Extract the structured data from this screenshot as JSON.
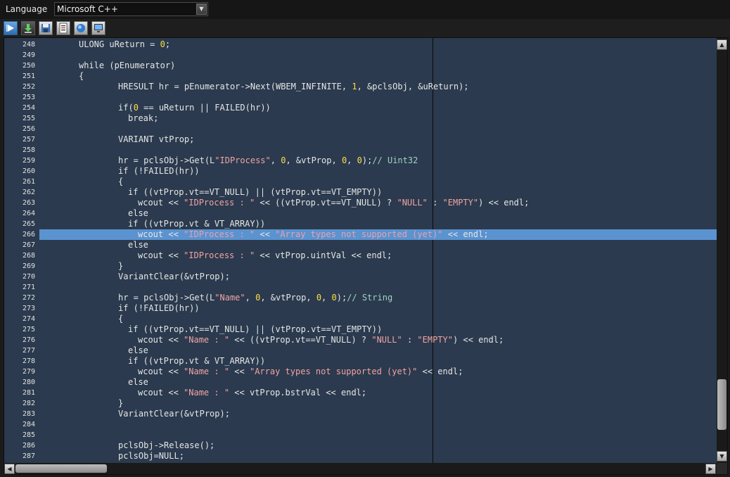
{
  "language": {
    "label": "Language",
    "selected": "Microsoft C++"
  },
  "toolbar": {
    "buttons": [
      {
        "name": "run-icon",
        "active": true
      },
      {
        "name": "download-icon"
      },
      {
        "name": "save-icon"
      },
      {
        "name": "properties-icon"
      },
      {
        "name": "globe-icon"
      },
      {
        "name": "monitor-icon"
      }
    ]
  },
  "editor": {
    "highlighted_line": 266,
    "lines": [
      {
        "n": "248",
        "indent": 1,
        "tokens": [
          [
            "t",
            "ULONG uReturn = "
          ],
          [
            "n",
            "0"
          ],
          [
            "t",
            ";"
          ]
        ]
      },
      {
        "n": "249",
        "indent": 0,
        "tokens": []
      },
      {
        "n": "250",
        "indent": 1,
        "tokens": [
          [
            "t",
            "while (pEnumerator)"
          ]
        ]
      },
      {
        "n": "251",
        "indent": 1,
        "tokens": [
          [
            "t",
            "{"
          ]
        ]
      },
      {
        "n": "252",
        "indent": 2,
        "tokens": [
          [
            "t",
            "HRESULT hr = pEnumerator->Next(WBEM_INFINITE, "
          ],
          [
            "n",
            "1"
          ],
          [
            "t",
            ", &pclsObj, &uReturn);"
          ]
        ]
      },
      {
        "n": "253",
        "indent": 0,
        "tokens": []
      },
      {
        "n": "254",
        "indent": 2,
        "tokens": [
          [
            "t",
            "if("
          ],
          [
            "n",
            "0"
          ],
          [
            "t",
            " == uReturn || FAILED(hr))"
          ]
        ]
      },
      {
        "n": "255",
        "indent": 3,
        "tokens": [
          [
            "t",
            "break;"
          ]
        ]
      },
      {
        "n": "256",
        "indent": 0,
        "tokens": []
      },
      {
        "n": "257",
        "indent": 2,
        "tokens": [
          [
            "t",
            "VARIANT vtProp;"
          ]
        ]
      },
      {
        "n": "258",
        "indent": 0,
        "tokens": []
      },
      {
        "n": "259",
        "indent": 2,
        "tokens": [
          [
            "t",
            "hr = pclsObj->Get(L"
          ],
          [
            "s",
            "\"IDProcess\""
          ],
          [
            "t",
            ", "
          ],
          [
            "n",
            "0"
          ],
          [
            "t",
            ", &vtProp, "
          ],
          [
            "n",
            "0"
          ],
          [
            "t",
            ", "
          ],
          [
            "n",
            "0"
          ],
          [
            "t",
            ");"
          ],
          [
            "c",
            "// Uint32"
          ]
        ]
      },
      {
        "n": "260",
        "indent": 2,
        "tokens": [
          [
            "t",
            "if (!FAILED(hr))"
          ]
        ]
      },
      {
        "n": "261",
        "indent": 2,
        "tokens": [
          [
            "t",
            "{"
          ]
        ]
      },
      {
        "n": "262",
        "indent": 3,
        "tokens": [
          [
            "t",
            "if ((vtProp.vt==VT_NULL) || (vtProp.vt==VT_EMPTY))"
          ]
        ]
      },
      {
        "n": "263",
        "indent": 4,
        "tokens": [
          [
            "t",
            "wcout << "
          ],
          [
            "s",
            "\"IDProcess : \""
          ],
          [
            "t",
            " << ((vtProp.vt==VT_NULL) ? "
          ],
          [
            "s",
            "\"NULL\""
          ],
          [
            "t",
            " : "
          ],
          [
            "s",
            "\"EMPTY\""
          ],
          [
            "t",
            ") << endl;"
          ]
        ]
      },
      {
        "n": "264",
        "indent": 3,
        "tokens": [
          [
            "t",
            "else"
          ]
        ]
      },
      {
        "n": "265",
        "indent": 3,
        "tokens": [
          [
            "t",
            "if ((vtProp.vt & VT_ARRAY))"
          ]
        ]
      },
      {
        "n": "266",
        "indent": 4,
        "tokens": [
          [
            "t",
            "wcout << "
          ],
          [
            "s",
            "\"IDProcess : \""
          ],
          [
            "t",
            " << "
          ],
          [
            "s",
            "\"Array types not supported (yet)\""
          ],
          [
            "t",
            " << endl;"
          ]
        ]
      },
      {
        "n": "267",
        "indent": 3,
        "tokens": [
          [
            "t",
            "else"
          ]
        ]
      },
      {
        "n": "268",
        "indent": 4,
        "tokens": [
          [
            "t",
            "wcout << "
          ],
          [
            "s",
            "\"IDProcess : \""
          ],
          [
            "t",
            " << vtProp.uintVal << endl;"
          ]
        ]
      },
      {
        "n": "269",
        "indent": 2,
        "tokens": [
          [
            "t",
            "}"
          ]
        ]
      },
      {
        "n": "270",
        "indent": 2,
        "tokens": [
          [
            "t",
            "VariantClear(&vtProp);"
          ]
        ]
      },
      {
        "n": "271",
        "indent": 0,
        "tokens": []
      },
      {
        "n": "272",
        "indent": 2,
        "tokens": [
          [
            "t",
            "hr = pclsObj->Get(L"
          ],
          [
            "s",
            "\"Name\""
          ],
          [
            "t",
            ", "
          ],
          [
            "n",
            "0"
          ],
          [
            "t",
            ", &vtProp, "
          ],
          [
            "n",
            "0"
          ],
          [
            "t",
            ", "
          ],
          [
            "n",
            "0"
          ],
          [
            "t",
            ");"
          ],
          [
            "c",
            "// String"
          ]
        ]
      },
      {
        "n": "273",
        "indent": 2,
        "tokens": [
          [
            "t",
            "if (!FAILED(hr))"
          ]
        ]
      },
      {
        "n": "274",
        "indent": 2,
        "tokens": [
          [
            "t",
            "{"
          ]
        ]
      },
      {
        "n": "275",
        "indent": 3,
        "tokens": [
          [
            "t",
            "if ((vtProp.vt==VT_NULL) || (vtProp.vt==VT_EMPTY))"
          ]
        ]
      },
      {
        "n": "276",
        "indent": 4,
        "tokens": [
          [
            "t",
            "wcout << "
          ],
          [
            "s",
            "\"Name : \""
          ],
          [
            "t",
            " << ((vtProp.vt==VT_NULL) ? "
          ],
          [
            "s",
            "\"NULL\""
          ],
          [
            "t",
            " : "
          ],
          [
            "s",
            "\"EMPTY\""
          ],
          [
            "t",
            ") << endl;"
          ]
        ]
      },
      {
        "n": "277",
        "indent": 3,
        "tokens": [
          [
            "t",
            "else"
          ]
        ]
      },
      {
        "n": "278",
        "indent": 3,
        "tokens": [
          [
            "t",
            "if ((vtProp.vt & VT_ARRAY))"
          ]
        ]
      },
      {
        "n": "279",
        "indent": 4,
        "tokens": [
          [
            "t",
            "wcout << "
          ],
          [
            "s",
            "\"Name : \""
          ],
          [
            "t",
            " << "
          ],
          [
            "s",
            "\"Array types not supported (yet)\""
          ],
          [
            "t",
            " << endl;"
          ]
        ]
      },
      {
        "n": "280",
        "indent": 3,
        "tokens": [
          [
            "t",
            "else"
          ]
        ]
      },
      {
        "n": "281",
        "indent": 4,
        "tokens": [
          [
            "t",
            "wcout << "
          ],
          [
            "s",
            "\"Name : \""
          ],
          [
            "t",
            " << vtProp.bstrVal << endl;"
          ]
        ]
      },
      {
        "n": "282",
        "indent": 2,
        "tokens": [
          [
            "t",
            "}"
          ]
        ]
      },
      {
        "n": "283",
        "indent": 2,
        "tokens": [
          [
            "t",
            "VariantClear(&vtProp);"
          ]
        ]
      },
      {
        "n": "284",
        "indent": 0,
        "tokens": []
      },
      {
        "n": "285",
        "indent": 0,
        "tokens": []
      },
      {
        "n": "286",
        "indent": 2,
        "tokens": [
          [
            "t",
            "pclsObj->Release();"
          ]
        ]
      },
      {
        "n": "287",
        "indent": 2,
        "tokens": [
          [
            "t",
            "pclsObj=NULL;"
          ]
        ]
      }
    ]
  },
  "scrollbars": {
    "vertical": {
      "up": "▲",
      "down": "▼"
    },
    "horizontal": {
      "left": "◀",
      "right": "▶"
    }
  }
}
